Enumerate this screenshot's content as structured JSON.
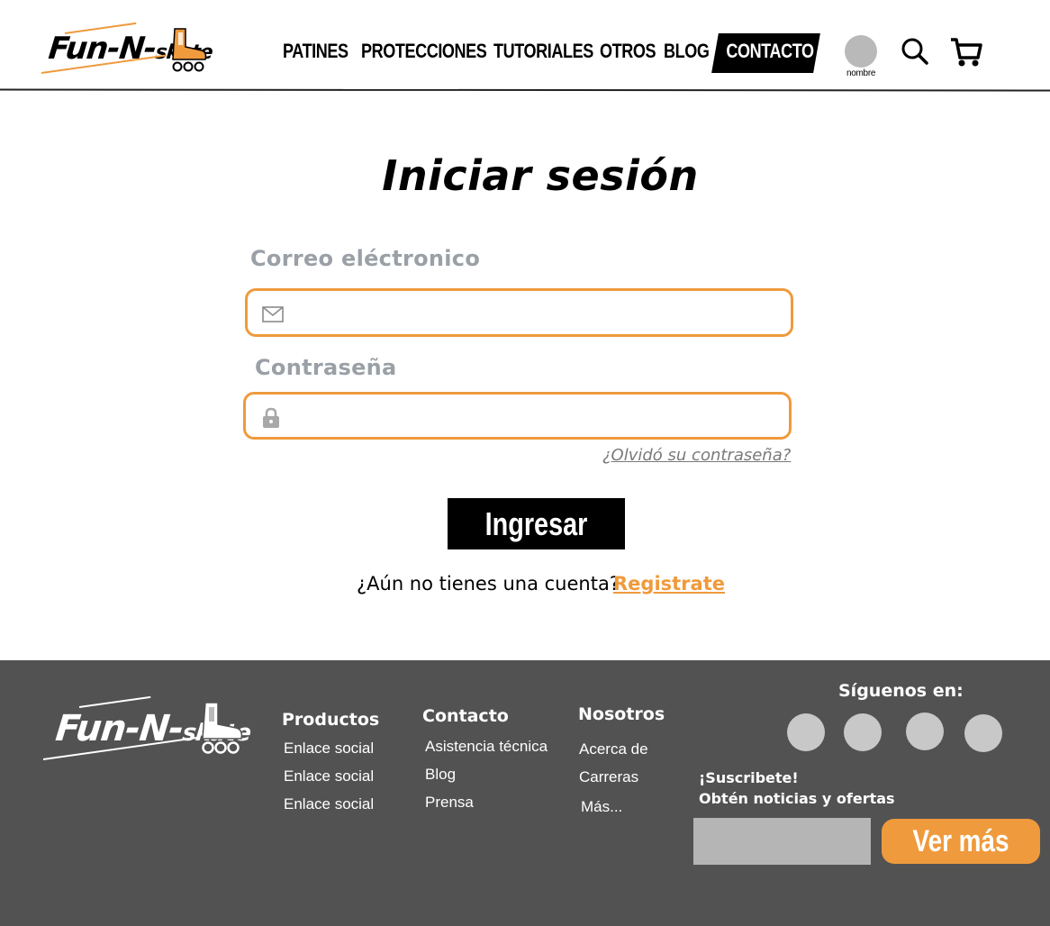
{
  "brand": {
    "name_part1": "Fun-N-",
    "name_part2": "skate",
    "accent_color": "#ef9a3c"
  },
  "nav": {
    "items": [
      {
        "label": "PATINES"
      },
      {
        "label": "PROTECCIONES"
      },
      {
        "label": "TUTORIALES"
      },
      {
        "label": "OTROS"
      },
      {
        "label": "BLOG"
      }
    ],
    "contact_label": "CONTACTO",
    "user_label": "nombre",
    "search_icon": "search-icon",
    "cart_icon": "cart-icon"
  },
  "login": {
    "title": "Iniciar sesión",
    "email_label": "Correo eléctronico",
    "email_value": "",
    "email_placeholder": "",
    "email_icon": "mail-icon",
    "password_label": "Contraseña",
    "password_value": "",
    "password_placeholder": "",
    "password_icon": "lock-icon",
    "forgot_label": "¿Olvidó su contraseña?",
    "submit_label": "Ingresar",
    "no_account_text": "¿Aún no tienes una cuenta?",
    "register_label": "Registrate"
  },
  "footer": {
    "columns": [
      {
        "title": "Productos",
        "links": [
          "Enlace social",
          "Enlace social",
          "Enlace social"
        ]
      },
      {
        "title": "Contacto",
        "links": [
          "Asistencia técnica",
          "Blog",
          "Prensa"
        ]
      },
      {
        "title": "Nosotros",
        "links": [
          "Acerca de",
          "Carreras",
          "Más..."
        ]
      }
    ],
    "follow_label": "Síguenos en:",
    "subscribe_title": "¡Suscribete!",
    "subscribe_subtitle": "Obtén noticias y ofertas",
    "subscribe_input_value": "",
    "subscribe_button": "Ver más",
    "background_color": "#525252"
  }
}
